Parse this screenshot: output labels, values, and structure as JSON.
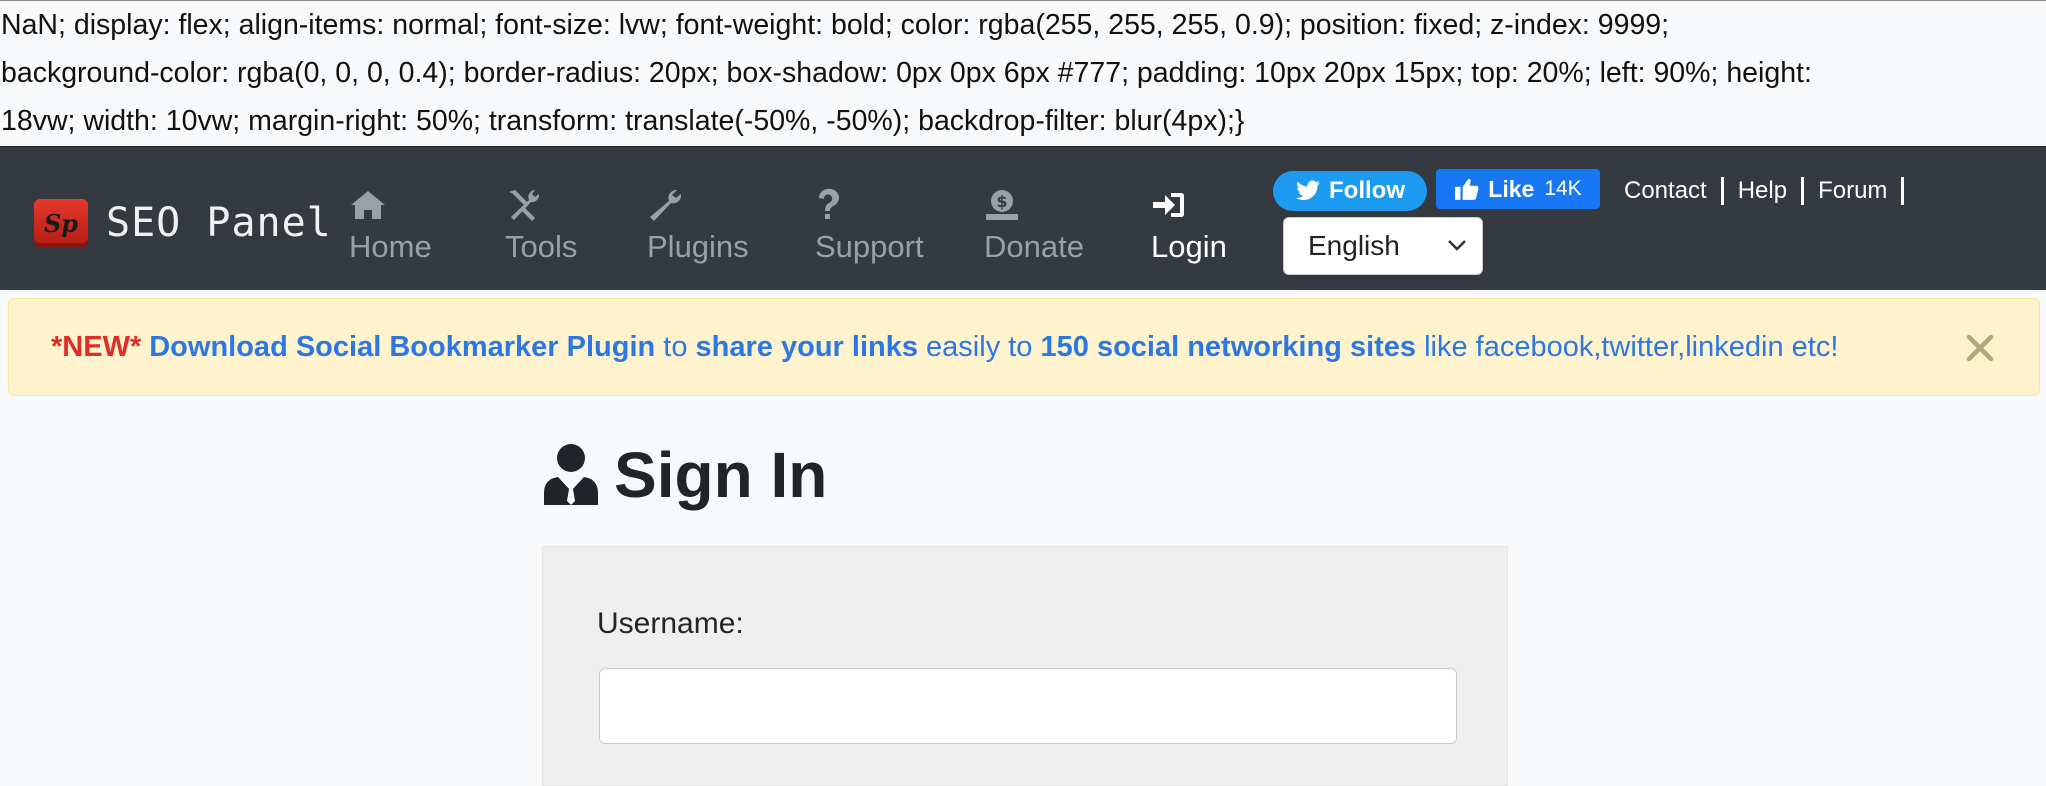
{
  "leaked_css": {
    "line1": "NaN; display: flex; align-items: normal; font-size: lvw; font-weight: bold; color: rgba(255, 255, 255, 0.9); position: fixed; z-index: 9999;",
    "line2": "background-color: rgba(0, 0, 0, 0.4); border-radius: 20px; box-shadow: 0px 0px 6px #777; padding: 10px 20px 15px; top: 20%; left: 90%; height:",
    "line3": "18vw; width: 10vw; margin-right: 50%; transform: translate(-50%, -50%); backdrop-filter: blur(4px);}"
  },
  "brand": {
    "name": "SEO Panel",
    "logo_text": "Sp",
    "logo_color": "#d72a1f"
  },
  "nav": {
    "items": [
      {
        "label": "Home",
        "icon": "home-icon"
      },
      {
        "label": "Tools",
        "icon": "tools-icon"
      },
      {
        "label": "Plugins",
        "icon": "wrench-icon"
      },
      {
        "label": "Support",
        "icon": "question-icon"
      },
      {
        "label": "Donate",
        "icon": "donate-icon"
      },
      {
        "label": "Login",
        "icon": "sign-in-icon",
        "active": true
      }
    ],
    "background": "#343a40",
    "inactive_color": "#9aa0a6",
    "active_color": "#ffffff"
  },
  "social": {
    "follow_label": "Follow",
    "follow_color": "#1d9bf0",
    "like_label": "Like",
    "like_count": "14K",
    "like_color": "#1877f2"
  },
  "top_links": {
    "contact": "Contact",
    "help": "Help",
    "forum": "Forum",
    "separator": "|"
  },
  "language": {
    "selected": "English"
  },
  "alert": {
    "new_tag": "*NEW*",
    "part1": "Download Social Bookmarker Plugin",
    "part2": "to",
    "part3": "share your links",
    "part4": "easily to",
    "part5": "150 social networking sites",
    "part6": "like facebook,twitter,linkedin etc!",
    "background": "#fff3cd",
    "link_color": "#2b78e4",
    "new_color": "#e02d25"
  },
  "signin": {
    "title": "Sign In",
    "username_label": "Username:",
    "username_value": ""
  }
}
